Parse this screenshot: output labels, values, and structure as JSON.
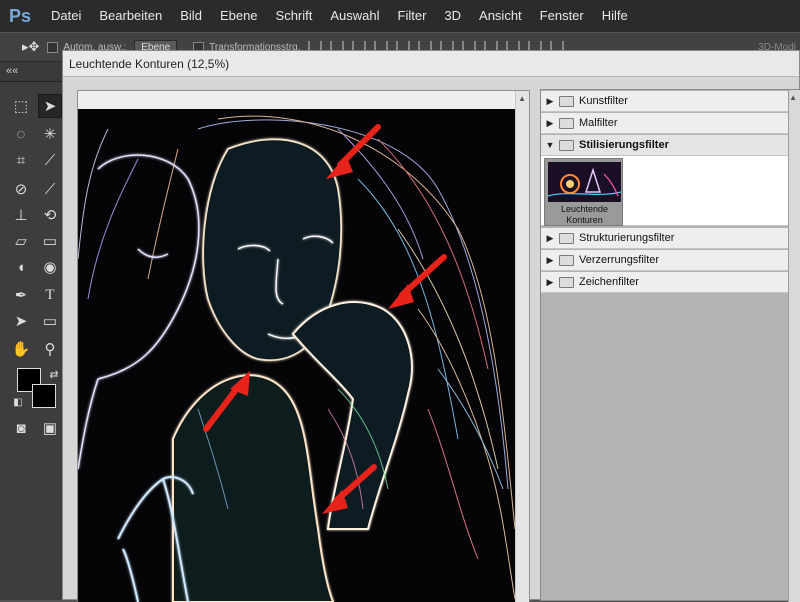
{
  "app": {
    "logo": "Ps"
  },
  "menubar": {
    "items": [
      "Datei",
      "Bearbeiten",
      "Bild",
      "Ebene",
      "Schrift",
      "Auswahl",
      "Filter",
      "3D",
      "Ansicht",
      "Fenster",
      "Hilfe"
    ]
  },
  "options": {
    "auto_select_label": "Autom. ausw.:",
    "auto_select_value": "Ebene",
    "transform_label": "Transformationsstrg.",
    "workspace_label": "3D-Modi"
  },
  "tabsrow": {
    "collapse_arrows": "««"
  },
  "dialog": {
    "title": "Leuchtende Konturen (12,5%)"
  },
  "filters": {
    "items": [
      {
        "label": "Kunstfilter",
        "expanded": false
      },
      {
        "label": "Malfilter",
        "expanded": false
      },
      {
        "label": "Stilisierungsfilter",
        "expanded": true
      },
      {
        "label": "Strukturierungsfilter",
        "expanded": false
      },
      {
        "label": "Verzerrungsfilter",
        "expanded": false
      },
      {
        "label": "Zeichenfilter",
        "expanded": false
      }
    ],
    "thumbnail_caption_line1": "Leuchtende",
    "thumbnail_caption_line2": "Konturen"
  },
  "colors": {
    "foreground": "#000000",
    "background": "#000000",
    "annotation_arrow": "#e8231c",
    "ps_logo": "#7aa7d8"
  },
  "icons": [
    "move-tool-icon",
    "marquee-tool-icon",
    "lasso-tool-icon",
    "magic-wand-icon",
    "crop-tool-icon",
    "eyedropper-icon",
    "healing-brush-icon",
    "brush-icon",
    "stamp-icon",
    "history-brush-icon",
    "eraser-icon",
    "gradient-icon",
    "blur-icon",
    "dodge-icon",
    "pen-icon",
    "type-icon",
    "path-select-icon",
    "shape-icon",
    "hand-icon",
    "zoom-icon",
    "quick-mask-icon",
    "screen-mode-icon"
  ]
}
